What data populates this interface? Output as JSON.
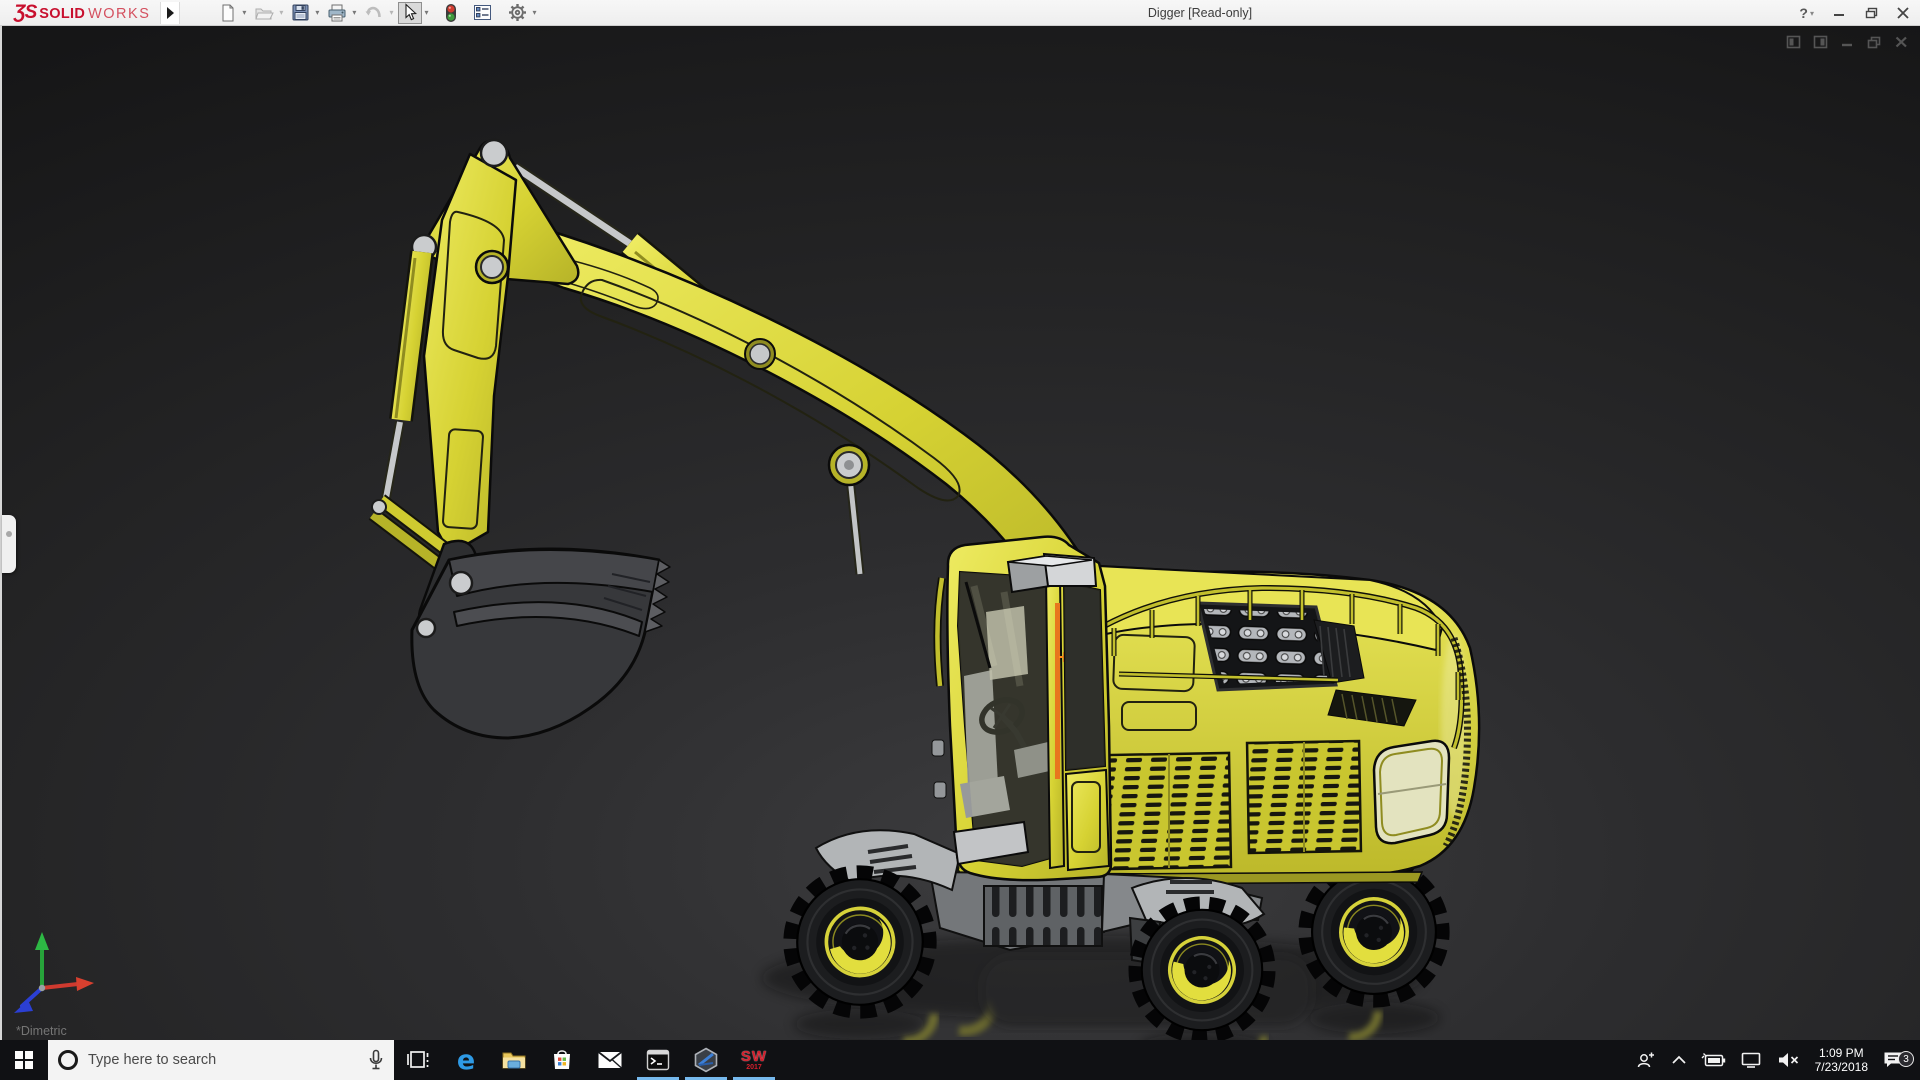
{
  "window": {
    "logo_glyph": "ƷS",
    "logo_solid": "SOLID",
    "logo_works": "WORKS",
    "title": "Digger [Read-only]",
    "help_label": "?"
  },
  "toolbar": {
    "items": [
      {
        "name": "new-document",
        "enabled": true,
        "has_dropdown": true
      },
      {
        "name": "open",
        "enabled": false,
        "has_dropdown": true
      },
      {
        "name": "save",
        "enabled": true,
        "has_dropdown": true
      },
      {
        "name": "print",
        "enabled": true,
        "has_dropdown": true
      },
      {
        "name": "undo",
        "enabled": false,
        "has_dropdown": true
      },
      {
        "name": "select",
        "enabled": true,
        "active": true,
        "has_dropdown": true
      },
      {
        "name": "rebuild-traffic-light",
        "enabled": true,
        "has_dropdown": false
      },
      {
        "name": "file-properties",
        "enabled": true,
        "has_dropdown": false
      },
      {
        "name": "options-gear",
        "enabled": true,
        "has_dropdown": true
      }
    ]
  },
  "viewport": {
    "orientation_label": "*Dimetric",
    "triad": {
      "x_color": "#d93a2b",
      "y_color": "#2ca83c",
      "z_color": "#2b3fd4"
    },
    "mdi_controls": [
      "pane-left",
      "pane-right",
      "minimize",
      "restore",
      "close"
    ]
  },
  "model": {
    "name": "Digger (wheeled excavator)",
    "primary_color": "#d6d233",
    "accent_orange": "#e8761e",
    "metal_color": "#c6c8ca",
    "tire_color": "#1a1b1d"
  },
  "taskbar": {
    "search_placeholder": "Type here to search",
    "apps": [
      "task-view",
      "edge",
      "file-explorer",
      "store",
      "mail",
      "command-prompt",
      "hexagon-app",
      "solidworks-2017"
    ],
    "running_apps": [
      "command-prompt",
      "hexagon-app",
      "solidworks-2017"
    ],
    "sw_badge": {
      "letters": "SW",
      "year": "2017"
    },
    "tray": {
      "time": "1:09 PM",
      "date": "7/23/2018",
      "notification_count": "3",
      "icons": [
        "people",
        "chevron-up",
        "battery",
        "network",
        "volume-mute",
        "action-center"
      ]
    }
  }
}
